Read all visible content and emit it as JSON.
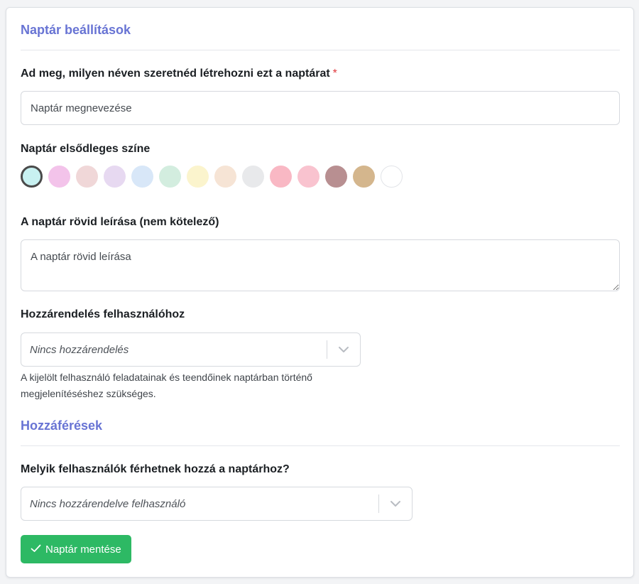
{
  "settings": {
    "title": "Naptár beállítások",
    "name_label": "Ad meg, milyen néven szeretnéd létrehozni ezt a naptárat",
    "required_mark": "*",
    "name_placeholder": "Naptár megnevezése",
    "color_label": "Naptár elsődleges színe",
    "colors": [
      "#c8f1f1",
      "#f3c3ea",
      "#f0d7d8",
      "#e7d9f1",
      "#d8e7f8",
      "#d3eddf",
      "#fbf4cd",
      "#f6e4d5",
      "#e8e9eb",
      "#f9b8c4",
      "#f9c3cf",
      "#b88f91",
      "#d4b68d",
      "#ffffff"
    ],
    "selected_color_index": 0,
    "description_label": "A naptár rövid leírása (nem kötelező)",
    "description_placeholder": "A naptár rövid leírása",
    "assign_label": "Hozzárendelés felhasználóhoz",
    "assign_value": "Nincs hozzárendelés",
    "assign_help": "A kijelölt felhasználó feladatainak és teendőinek naptárban történő megjelenítéséshez szükséges."
  },
  "access": {
    "title": "Hozzáférések",
    "users_label": "Melyik felhasználók férhetnek hozzá a naptárhoz?",
    "users_value": "Nincs hozzárendelve felhasználó"
  },
  "save_button": {
    "icon": "check-icon",
    "label": "Naptár mentése",
    "color": "#2db964"
  },
  "accent_color": "#6874d4"
}
